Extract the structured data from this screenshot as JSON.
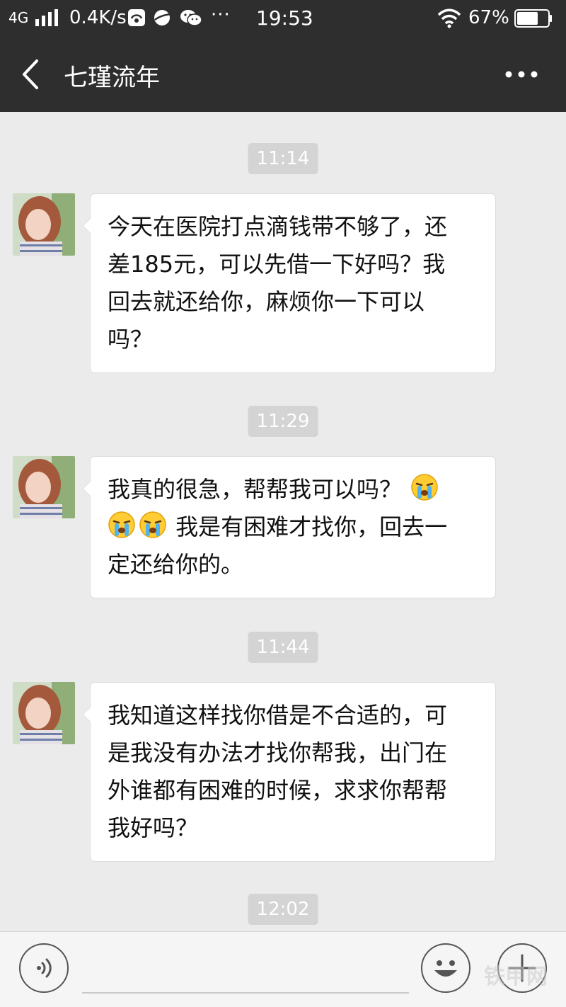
{
  "status_bar": {
    "network": "4G",
    "speed": "0.4K/s",
    "overflow": "···",
    "time": "19:53",
    "battery": "67%"
  },
  "header": {
    "title": "七瑾流年"
  },
  "messages": [
    {
      "time": "11:14",
      "lines": [
        "今天在医院打点滴钱带不够了，还",
        "差185元，可以先借一下好吗？我",
        "回去就还给你，麻烦你一下可以",
        "吗？"
      ]
    },
    {
      "time": "11:29",
      "line1": "我真的很急，帮帮我可以吗？",
      "line2": "我是有困难才找你，回去一",
      "line3": "定还给你的。"
    },
    {
      "time": "11:44",
      "lines": [
        "我知道这样找你借是不合适的，可",
        "是我没有办法才找你帮我，出门在",
        "外谁都有困难的时候，求求你帮帮",
        "我好吗？"
      ]
    },
    {
      "time": "12:02"
    }
  ],
  "input_bar": {
    "watermark": "铁甲网"
  },
  "colors": {
    "header_bg": "#2e2e2e",
    "chat_bg": "#ebebeb",
    "bubble_bg": "#ffffff",
    "time_pill_bg": "#d4d4d4"
  },
  "icons": {
    "back": "chevron-left-icon",
    "more": "more-horizontal-icon",
    "voice": "voice-icon",
    "emoji": "smiley-icon",
    "plus": "plus-icon",
    "crying": "crying-emoji-icon"
  }
}
